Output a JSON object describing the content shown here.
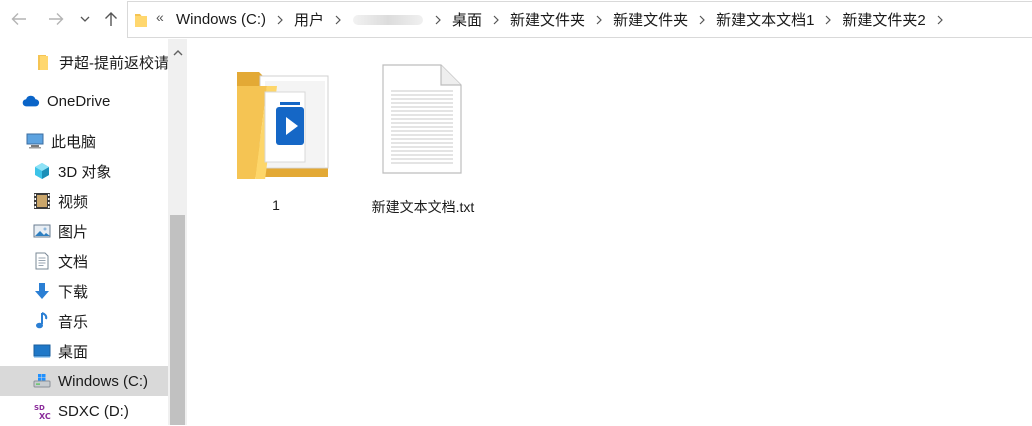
{
  "address_bar": {
    "overflow_glyph": "«",
    "crumbs": [
      "Windows (C:)",
      "用户",
      "桌面",
      "新建文件夹",
      "新建文件夹",
      "新建文本文档1",
      "新建文件夹2"
    ]
  },
  "nav_buttons": {
    "back": "back-arrow",
    "forward": "forward-arrow",
    "recent": "chevron-down",
    "up": "up-arrow"
  },
  "sidebar": {
    "items": [
      {
        "label": "尹超-提前返校请",
        "icon": "folder-icon"
      },
      {
        "label": "OneDrive",
        "icon": "onedrive-cloud-icon"
      },
      {
        "label": "此电脑",
        "icon": "this-pc-icon"
      },
      {
        "label": "3D 对象",
        "icon": "3d-objects-icon"
      },
      {
        "label": "视频",
        "icon": "videos-icon"
      },
      {
        "label": "图片",
        "icon": "pictures-icon"
      },
      {
        "label": "文档",
        "icon": "documents-icon"
      },
      {
        "label": "下载",
        "icon": "downloads-icon"
      },
      {
        "label": "音乐",
        "icon": "music-icon"
      },
      {
        "label": "桌面",
        "icon": "desktop-icon"
      },
      {
        "label": "Windows (C:)",
        "icon": "drive-c-icon",
        "selected": true
      },
      {
        "label": "SDXC (D:)",
        "icon": "sdxc-drive-icon"
      }
    ]
  },
  "files": [
    {
      "name": "1",
      "type": "folder"
    },
    {
      "name": "新建文本文档.txt",
      "type": "text-file"
    }
  ],
  "colors": {
    "selection": "#d9d9d9",
    "folder": "#f5c453",
    "accent": "#0a64c8"
  }
}
